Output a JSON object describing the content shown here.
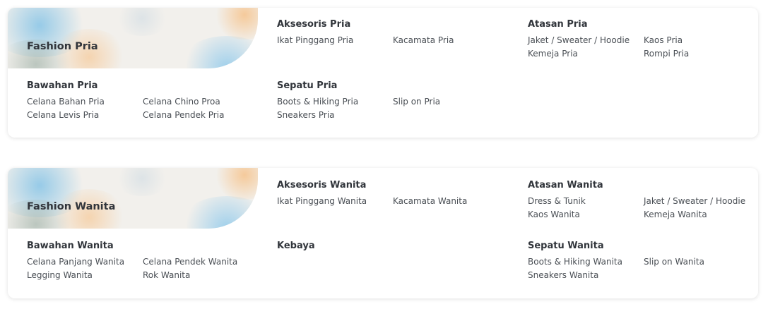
{
  "sections": [
    {
      "banner_title": "Fashion Pria",
      "groups": [
        {
          "title": "Aksesoris Pria",
          "items": [
            "Ikat Pinggang Pria",
            "Kacamata Pria"
          ]
        },
        {
          "title": "Atasan Pria",
          "items": [
            "Jaket / Sweater / Hoodie",
            "Kaos Pria",
            "Kemeja Pria",
            "Rompi Pria"
          ]
        },
        {
          "title": "Bawahan Pria",
          "items": [
            "Celana Bahan Pria",
            "Celana Chino Proa",
            "Celana Levis Pria",
            "Celana Pendek Pria"
          ]
        },
        {
          "title": "Sepatu Pria",
          "items": [
            "Boots & Hiking Pria",
            "Slip on Pria",
            "Sneakers Pria"
          ]
        }
      ]
    },
    {
      "banner_title": "Fashion Wanita",
      "groups": [
        {
          "title": "Aksesoris Wanita",
          "items": [
            "Ikat Pinggang Wanita",
            "Kacamata Wanita"
          ]
        },
        {
          "title": "Atasan Wanita",
          "items": [
            "Dress & Tunik",
            "Jaket / Sweater / Hoodie",
            "Kaos Wanita",
            "Kemeja Wanita"
          ]
        },
        {
          "title": "Bawahan Wanita",
          "items": [
            "Celana Panjang Wanita",
            "Celana Pendek Wanita",
            "Legging Wanita",
            "Rok Wanita"
          ]
        },
        {
          "title": "Kebaya",
          "items": []
        },
        {
          "title": "Sepatu Wanita",
          "items": [
            "Boots & Hiking Wanita",
            "Slip on Wanita",
            "Sneakers Wanita"
          ]
        }
      ]
    }
  ]
}
